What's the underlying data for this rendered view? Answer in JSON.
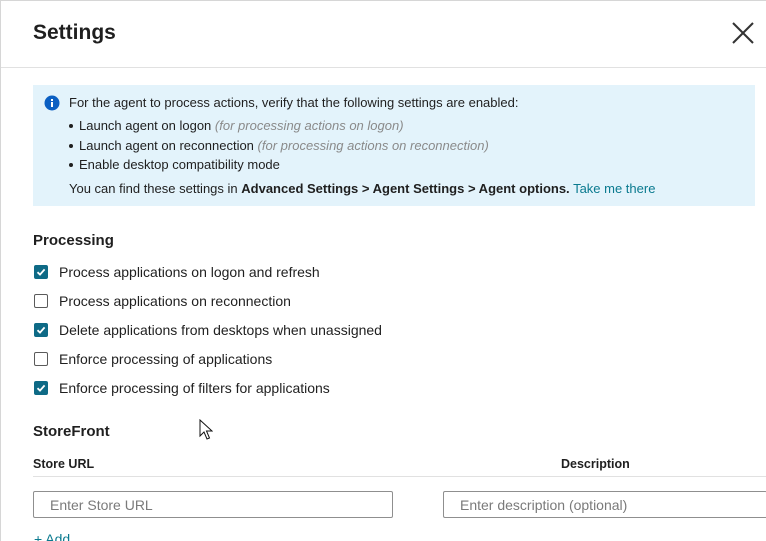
{
  "header": {
    "title": "Settings",
    "close_icon": "close-icon"
  },
  "info": {
    "icon": "info-circle-icon",
    "color": "#e3f3fb",
    "intro": "For the agent to process actions, verify that the following settings are enabled:",
    "bullets": [
      {
        "text": "Launch agent on logon",
        "hint": "(for processing actions on logon)"
      },
      {
        "text": "Launch agent on reconnection",
        "hint": "(for processing actions on reconnection)"
      },
      {
        "text": "Enable desktop compatibility mode",
        "hint": ""
      }
    ],
    "footer_prefix": "You can find these settings in",
    "footer_path": "Advanced Settings > Agent Settings > Agent options.",
    "footer_link": "Take me there"
  },
  "processing": {
    "title": "Processing",
    "accent": "#0e6a86",
    "options": [
      {
        "label": "Process applications on logon and refresh",
        "checked": true
      },
      {
        "label": "Process applications on reconnection",
        "checked": false
      },
      {
        "label": "Delete applications from desktops when unassigned",
        "checked": true
      },
      {
        "label": "Enforce processing of applications",
        "checked": false
      },
      {
        "label": "Enforce processing of filters for applications",
        "checked": true
      }
    ]
  },
  "storefront": {
    "title": "StoreFront",
    "col_url": "Store URL",
    "col_description": "Description",
    "url_placeholder": "Enter Store URL",
    "description_placeholder": "Enter description (optional)",
    "add_label": "+ Add"
  }
}
